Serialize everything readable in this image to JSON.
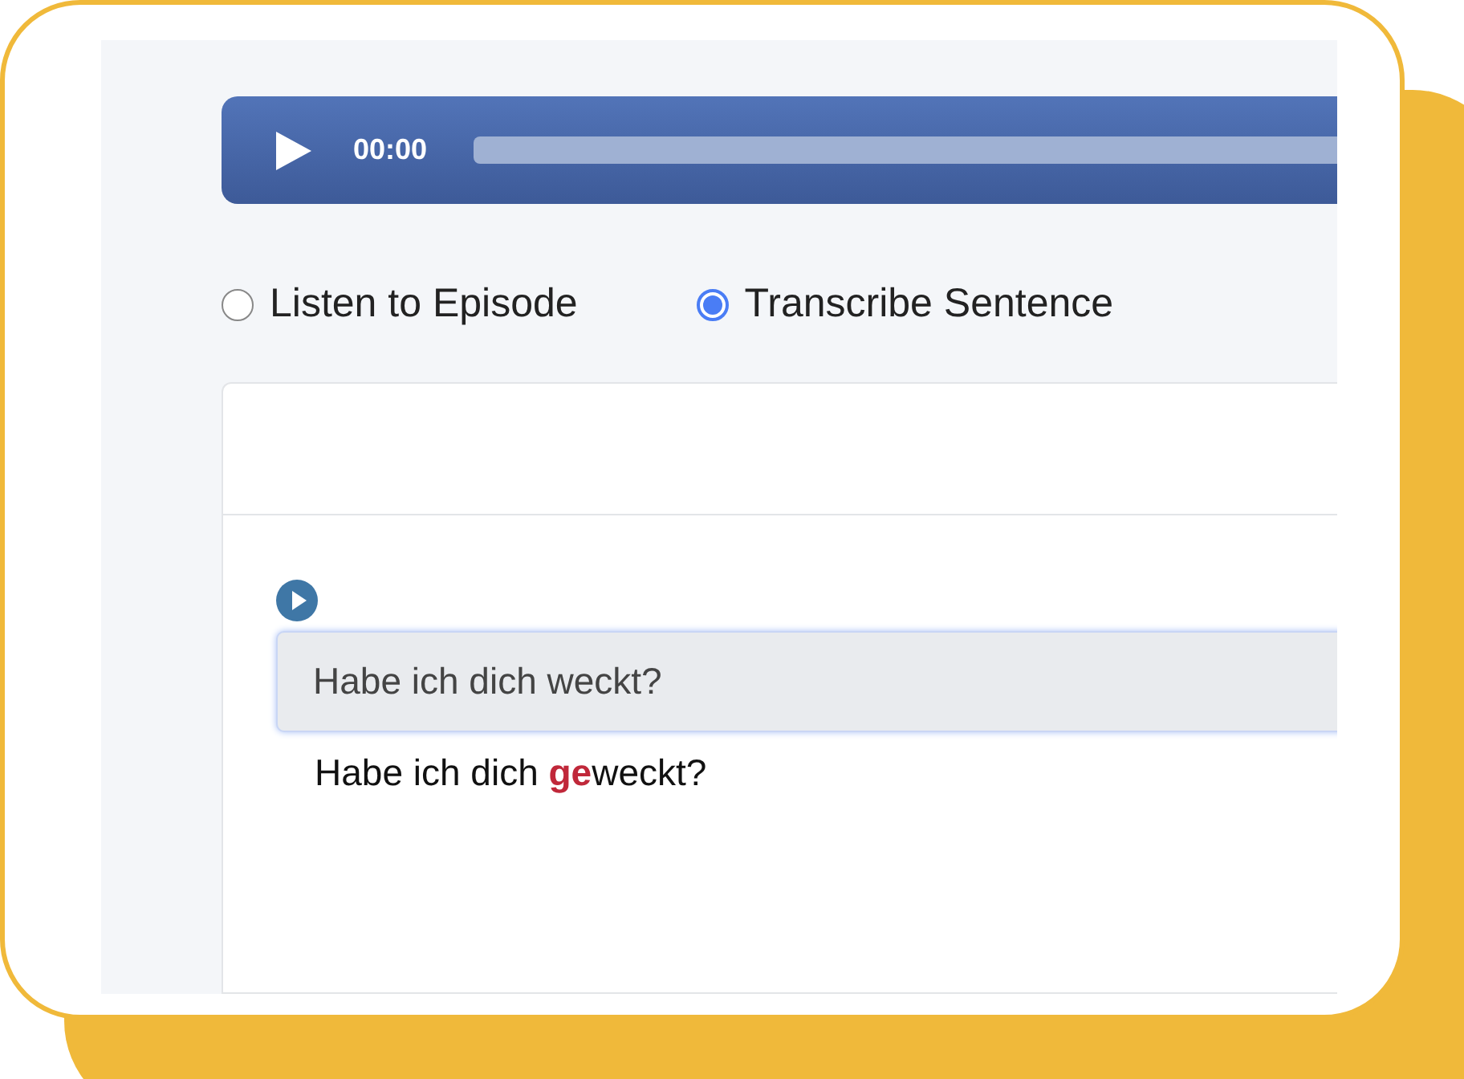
{
  "player": {
    "time": "00:00"
  },
  "modes": [
    {
      "label": "Listen to Episode",
      "selected": false
    },
    {
      "label": "Transcribe Sentence",
      "selected": true
    }
  ],
  "exercise": {
    "answer": "Habe ich dich weckt?",
    "correction": "Habe ich dich **ge**weckt?"
  }
}
